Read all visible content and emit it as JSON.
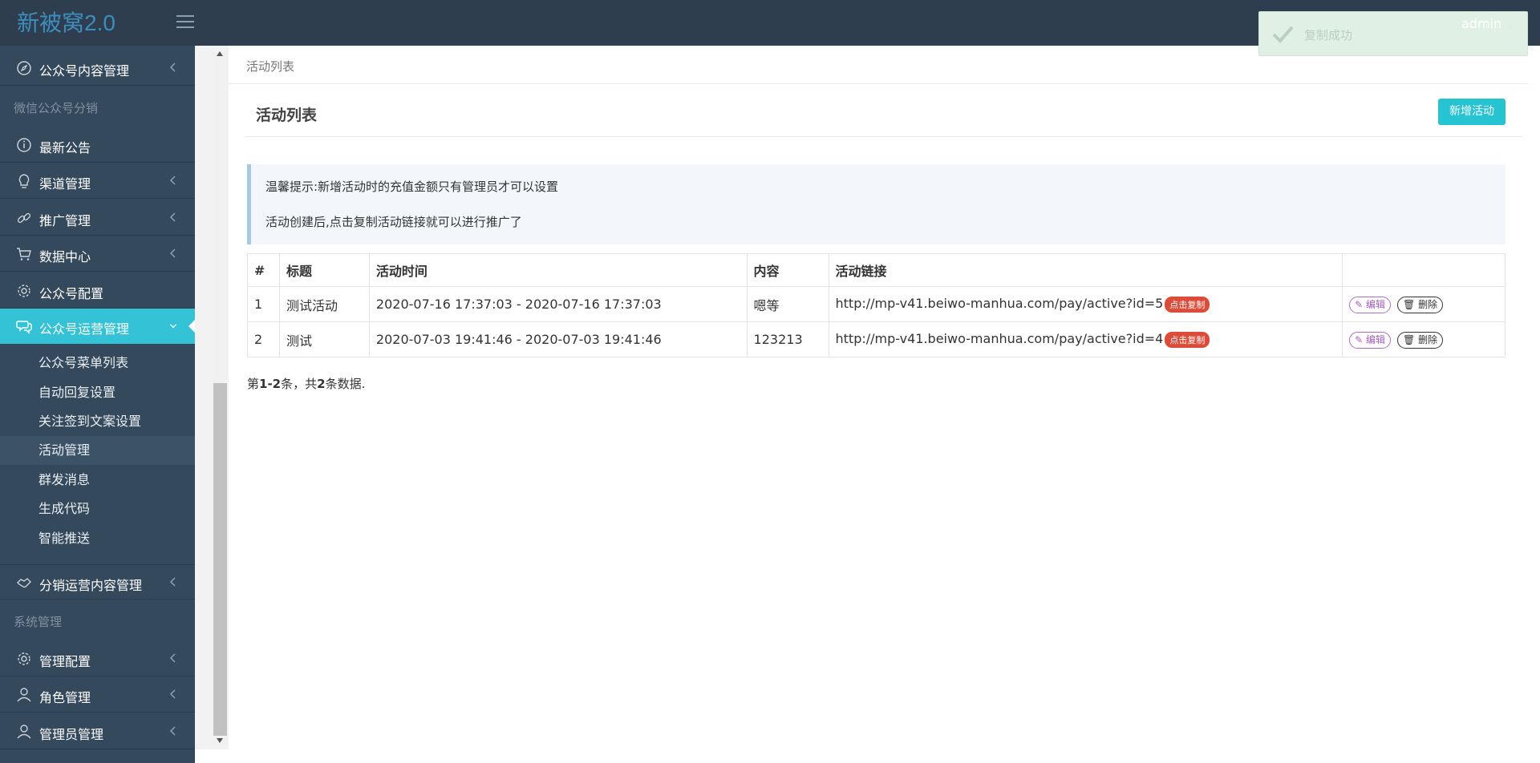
{
  "app": {
    "title": "新被窝2.0"
  },
  "header": {
    "user": "admin"
  },
  "toast": {
    "text": "复制成功"
  },
  "sidebar": {
    "items": [
      {
        "label": "公众号内容管理",
        "icon": "compass-icon",
        "has_arrow": true
      },
      {
        "section": "微信公众号分销"
      },
      {
        "label": "最新公告",
        "icon": "info-icon",
        "has_arrow": false
      },
      {
        "label": "渠道管理",
        "icon": "lightbulb-icon",
        "has_arrow": true
      },
      {
        "label": "推广管理",
        "icon": "link-icon",
        "has_arrow": true
      },
      {
        "label": "数据中心",
        "icon": "cart-icon",
        "has_arrow": true
      },
      {
        "label": "公众号配置",
        "icon": "gear-icon",
        "has_arrow": false
      },
      {
        "label": "公众号运营管理",
        "icon": "chat-icon",
        "has_arrow": true,
        "active": true
      },
      {
        "label": "分销运营内容管理",
        "icon": "handshake-icon",
        "has_arrow": true
      },
      {
        "section": "系统管理"
      },
      {
        "label": "管理配置",
        "icon": "gear-icon",
        "has_arrow": true
      },
      {
        "label": "角色管理",
        "icon": "user-icon",
        "has_arrow": true
      },
      {
        "label": "管理员管理",
        "icon": "user-icon",
        "has_arrow": true
      }
    ],
    "submenu": [
      {
        "label": "公众号菜单列表"
      },
      {
        "label": "自动回复设置"
      },
      {
        "label": "关注签到文案设置"
      },
      {
        "label": "活动管理",
        "current": true
      },
      {
        "label": "群发消息"
      },
      {
        "label": "生成代码"
      },
      {
        "label": "智能推送"
      }
    ]
  },
  "breadcrumb": "活动列表",
  "page": {
    "title": "活动列表",
    "new_button": "新增活动",
    "tips": [
      "温馨提示:新增活动时的充值金额只有管理员才可以设置",
      "活动创建后,点击复制活动链接就可以进行推广了"
    ]
  },
  "table": {
    "columns": [
      "#",
      "标题",
      "活动时间",
      "内容",
      "活动链接",
      ""
    ],
    "rows": [
      {
        "id": "1",
        "title": "测试活动",
        "time": "2020-07-16 17:37:03 - 2020-07-16 17:37:03",
        "content": "嗯等",
        "link": "http://mp-v41.beiwo-manhua.com/pay/active?id=5"
      },
      {
        "id": "2",
        "title": "测试",
        "time": "2020-07-03 19:41:46 - 2020-07-03 19:41:46",
        "content": "123213",
        "link": "http://mp-v41.beiwo-manhua.com/pay/active?id=4"
      }
    ],
    "copy_label": "点击复制",
    "edit_label": "编辑",
    "delete_label": "删除"
  },
  "summary": {
    "prefix": "第",
    "range": "1-2",
    "middle": "条，共",
    "total": "2",
    "suffix": "条数据."
  }
}
